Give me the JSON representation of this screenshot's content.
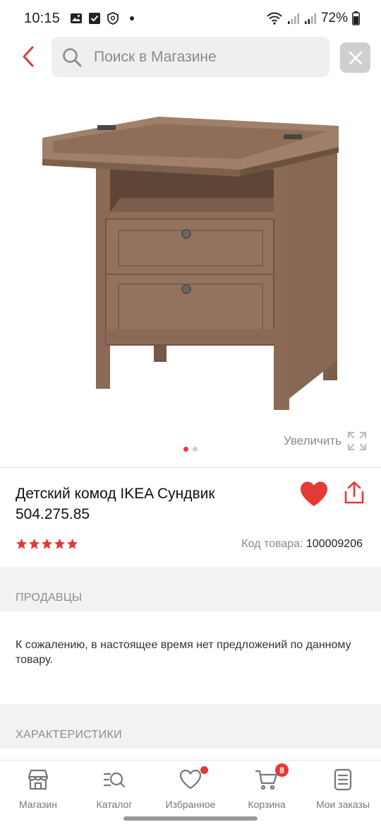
{
  "status_bar": {
    "time": "10:15",
    "battery": "72%"
  },
  "search": {
    "placeholder": "Поиск в Магазине",
    "value": ""
  },
  "gallery": {
    "zoom_label": "Увеличить",
    "pages": 2,
    "active_page": 1
  },
  "product": {
    "title": "Детский комод IKEA Сундвик 504.275.85",
    "rating": 5,
    "sku_label": "Код товара:",
    "sku_value": "100009206"
  },
  "sellers": {
    "header": "ПРОДАВЦЫ",
    "message": "К сожалению, в настоящее время нет предложений по данному товару."
  },
  "characteristics": {
    "header": "ХАРАКТЕРИСТИКИ"
  },
  "bottom_nav": {
    "items": [
      {
        "label": "Магазин",
        "icon": "store-icon"
      },
      {
        "label": "Каталог",
        "icon": "catalog-search-icon"
      },
      {
        "label": "Избранное",
        "icon": "heart-outline-icon"
      },
      {
        "label": "Корзина",
        "icon": "cart-icon",
        "badge": "8"
      },
      {
        "label": "Мои заказы",
        "icon": "orders-icon"
      }
    ]
  },
  "colors": {
    "accent": "#e53935",
    "muted_text": "#8a8a8a",
    "section_bg": "#f2f2f2"
  }
}
